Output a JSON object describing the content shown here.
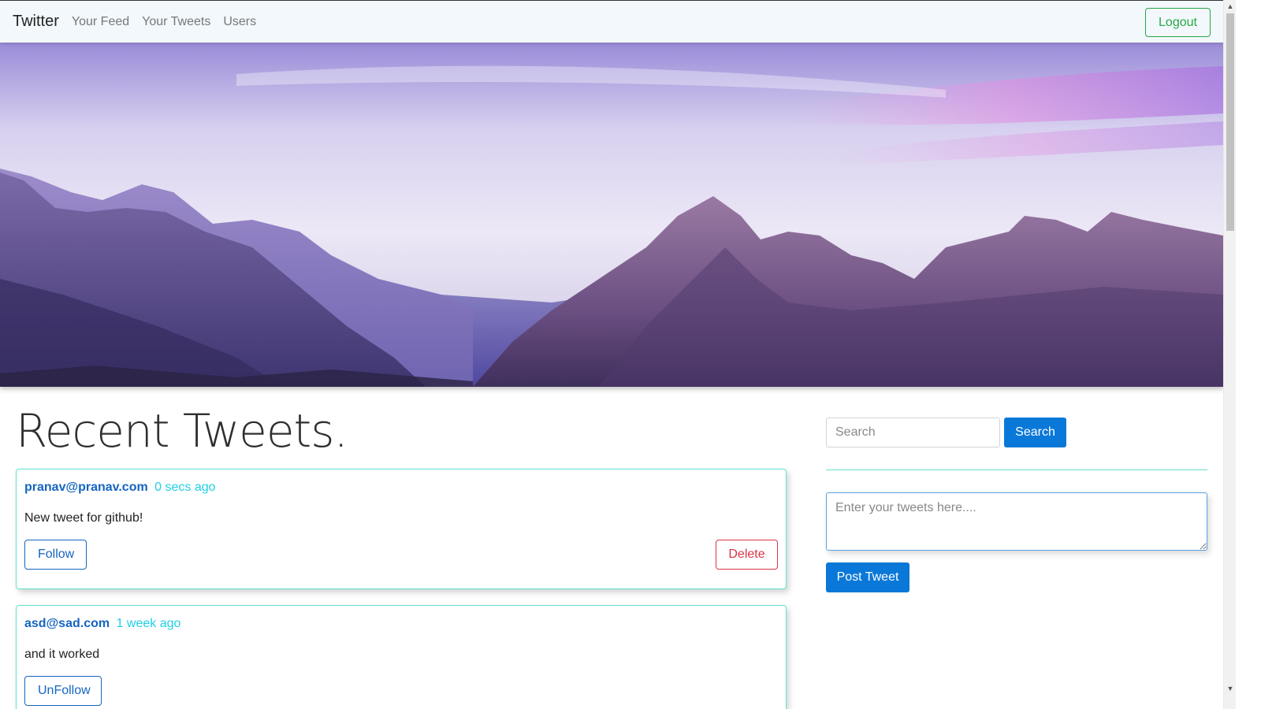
{
  "navbar": {
    "brand": "Twitter",
    "links": [
      "Your Feed",
      "Your Tweets",
      "Users"
    ],
    "logout_label": "Logout"
  },
  "main": {
    "title": "Recent Tweets.",
    "tweets": [
      {
        "user": "pranav@pranav.com",
        "time": "0 secs ago",
        "text": "New tweet for github!",
        "follow_label": "Follow",
        "delete_label": "Delete"
      },
      {
        "user": "asd@sad.com",
        "time": "1 week ago",
        "text": "and it worked",
        "follow_label": "UnFollow"
      }
    ]
  },
  "sidebar": {
    "search_placeholder": "Search",
    "search_label": "Search",
    "tweet_placeholder": "Enter your tweets here....",
    "post_label": "Post Tweet"
  },
  "colors": {
    "primary": "#0a78d8",
    "success": "#28a745",
    "danger": "#dc3545",
    "card_border": "#5fe3cf",
    "username": "#1565c0",
    "timestamp": "#1ed0e6",
    "navbar_bg": "#f2f8fc"
  },
  "icons": [
    "scroll-up-arrow-icon",
    "scroll-down-arrow-icon",
    "resize-grip-icon"
  ]
}
